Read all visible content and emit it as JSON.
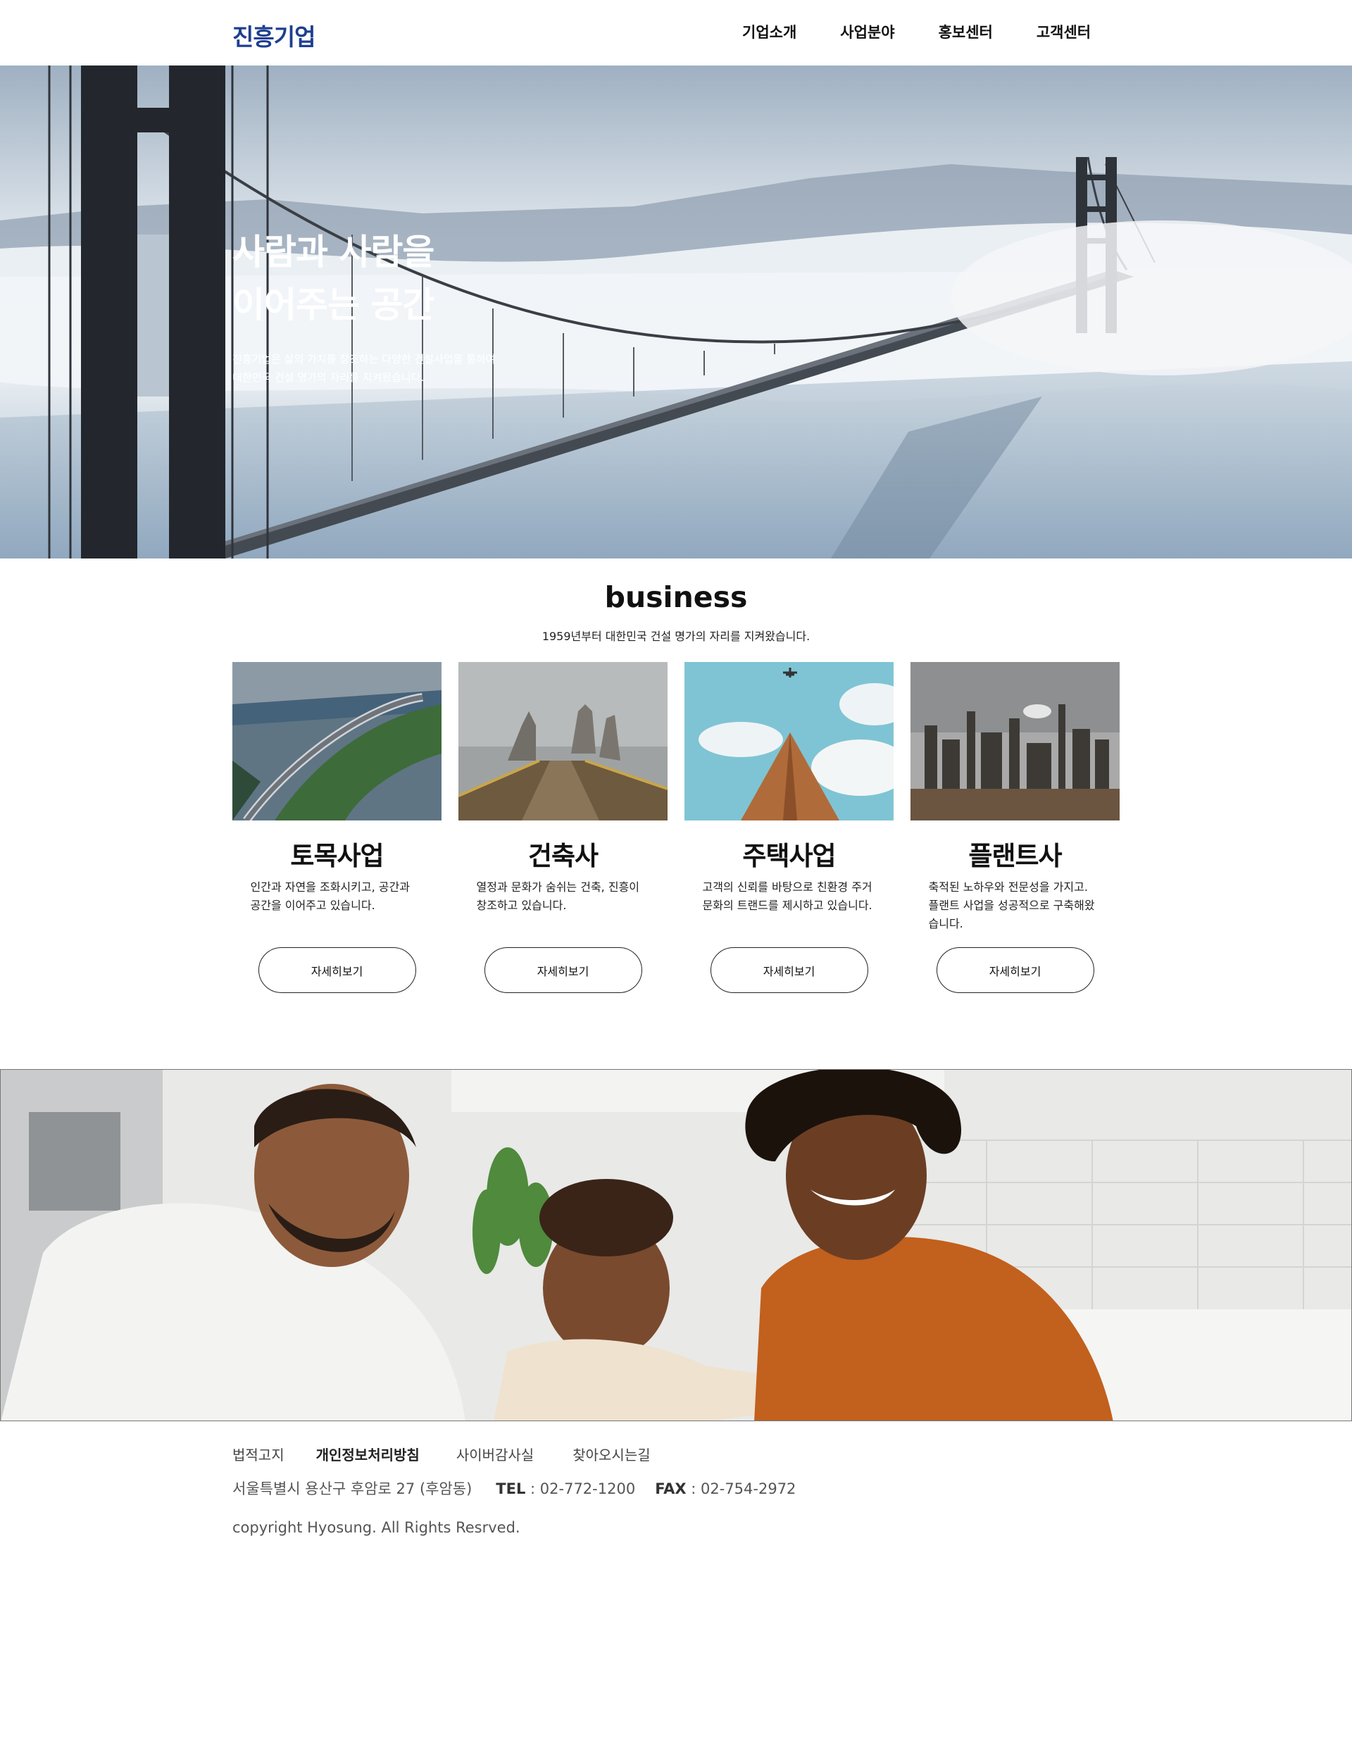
{
  "header": {
    "logo": "진흥기업",
    "nav": [
      "기업소개",
      "사업분야",
      "홍보센터",
      "고객센터"
    ]
  },
  "hero": {
    "title_line1": "사람과 사람을",
    "title_line2": "이어주는 공간",
    "desc_line1": "진흥기업은 삶의 가치를 창조하는 다양한 건설사업을 통하여",
    "desc_line2": "대한민국 건설 명가의 자리를 지켜왔습니다."
  },
  "business": {
    "title": "business",
    "subtitle": "1959년부터 대한민국 건설 명가의 자리를 지켜왔습니다.",
    "cards": [
      {
        "title": "토목사업",
        "desc": "인간과 자연을 조화시키고, 공간과 공간을 이어주고 있습니다.",
        "button": "자세히보기"
      },
      {
        "title": "건축사",
        "desc": "열정과 문화가 숨쉬는 건축, 진흥이 창조하고 있습니다.",
        "button": "자세히보기"
      },
      {
        "title": "주택사업",
        "desc": "고객의 신뢰를 바탕으로 친환경 주거 문화의 트랜드를 제시하고 있습니다.",
        "button": "자세히보기"
      },
      {
        "title": "플랜트사",
        "desc": "축적된 노하우와 전문성을 가지고. 플랜트 사업을 성공적으로 구축해왔습니다.",
        "button": "자세히보기"
      }
    ]
  },
  "footer": {
    "links": [
      "법적고지",
      "개인정보처리방침",
      "사이버감사실",
      "찾아오시는길"
    ],
    "address": "서울특별시 용산구 후암로 27 (후암동)",
    "tel_label": "TEL",
    "tel": " : 02-772-1200",
    "fax_label": "FAX",
    "fax": " : 02-754-2972",
    "copyright": "copyright Hyosung. All Rights Resrved."
  },
  "colors": {
    "logo": "#1e3f8f",
    "text": "#111111",
    "footer_text": "#555555"
  }
}
